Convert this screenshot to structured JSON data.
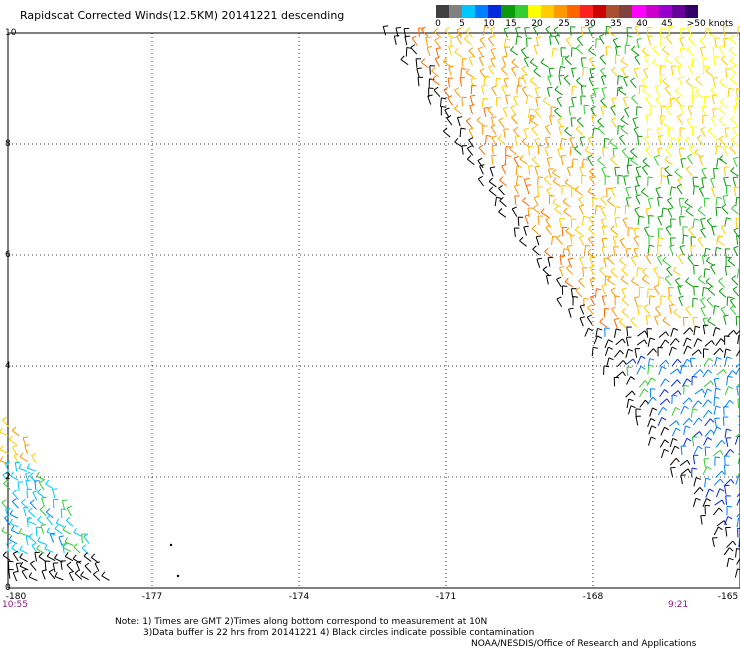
{
  "title": "Rapidscat Corrected Winds(12.5KM) 20141221 descending",
  "legend": {
    "colors": [
      "#404040",
      "#808080",
      "#00c8ff",
      "#0080ff",
      "#0028dc",
      "#0b9a0b",
      "#33cc33",
      "#ffff00",
      "#ffcc00",
      "#ff9900",
      "#ff6600",
      "#ff2020",
      "#cc0000",
      "#aa5030",
      "#804040",
      "#ff00ff",
      "#cc00cc",
      "#9900cc",
      "#660099",
      "#330066"
    ],
    "labels": [
      "0",
      "5",
      "10",
      "15",
      "20",
      "25",
      "30",
      "35",
      "40",
      "45",
      ">50 knots"
    ]
  },
  "y_ticks": [
    "10",
    "8",
    "6",
    "4",
    "2",
    "0"
  ],
  "x_ticks": [
    "-180",
    "-177",
    "-174",
    "-171",
    "-168",
    "-165"
  ],
  "time_left": "10:55",
  "time_right": "9:21",
  "notes": [
    "Note: 1) Times are GMT 2)Times along bottom correspond to measurement at 10N",
    "3)Data buffer is 22 hrs from 20141221 4) Black circles indicate possible contamination",
    "NOAA/NESDIS/Office of Research and Applications"
  ],
  "map": {
    "lon_range": [
      -180,
      -165
    ],
    "lat_range": [
      0,
      10
    ],
    "gridlines": "dotted"
  }
}
